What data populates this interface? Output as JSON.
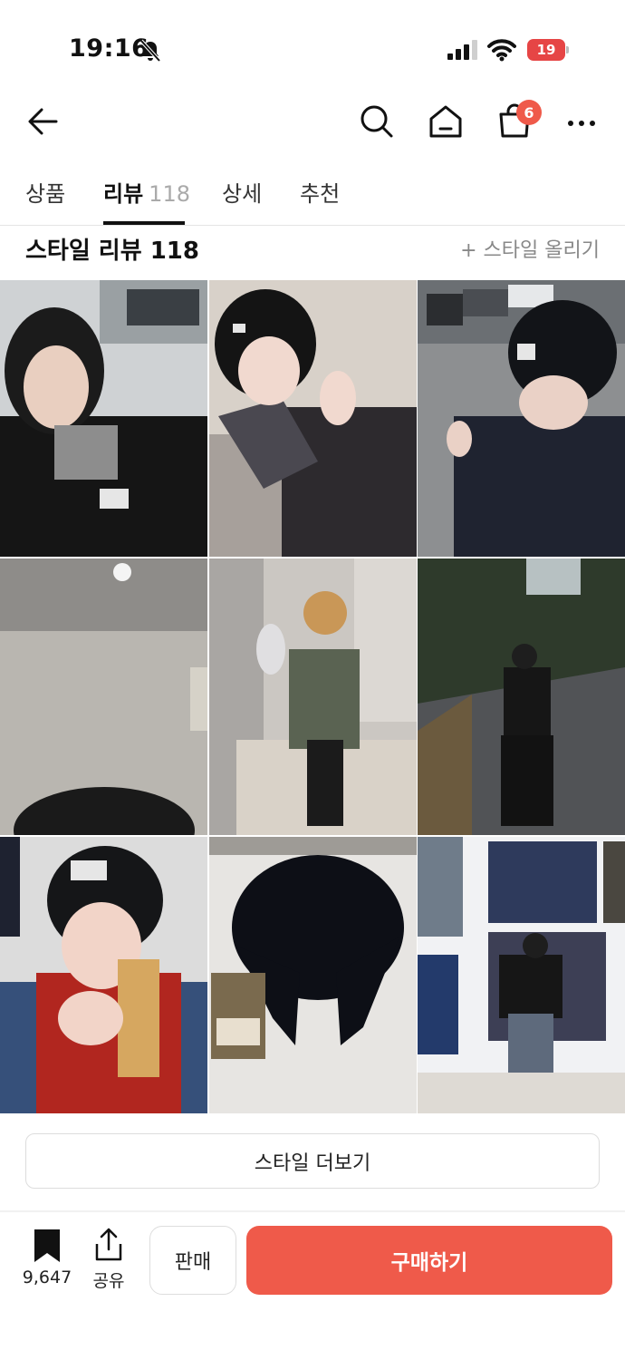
{
  "status_bar": {
    "time": "19:16",
    "battery": "19"
  },
  "nav": {
    "cart_badge": "6"
  },
  "tabs": [
    {
      "label": "상품"
    },
    {
      "label": "리뷰",
      "count": "118"
    },
    {
      "label": "상세"
    },
    {
      "label": "추천"
    }
  ],
  "section": {
    "title": "스타일 리뷰 118",
    "upload_link": "+ 스타일 올리기"
  },
  "more_button": "스타일 더보기",
  "bottom": {
    "save_count": "9,647",
    "share_label": "공유",
    "sell_label": "판매",
    "buy_label": "구매하기"
  },
  "colors": {
    "accent": "#ef5a4a",
    "battery": "#e64545"
  },
  "icons": [
    "bell-off-icon",
    "signal-icon",
    "wifi-icon",
    "battery-icon",
    "back-arrow-icon",
    "search-icon",
    "home-icon",
    "shopping-bag-icon",
    "more-icon",
    "bookmark-icon",
    "share-icon"
  ]
}
